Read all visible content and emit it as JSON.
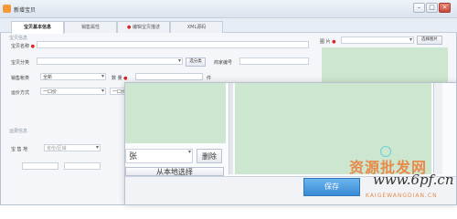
{
  "window": {
    "title": "新增宝贝"
  },
  "tabs": [
    {
      "label": "宝贝基本信息",
      "required": false
    },
    {
      "label": "销售属性",
      "required": false
    },
    {
      "label": "编辑宝贝描述",
      "required": true
    },
    {
      "label": "XML源码",
      "required": false
    }
  ],
  "basic": {
    "section_title": "宝贝信息",
    "name_label": "宝贝名称",
    "category_label": "宝贝分类",
    "category_button": "选分类",
    "merchant_code_label": "商家编号",
    "sale_label": "销售帐类",
    "sale_value": "全新",
    "qty_label": "数 量",
    "qty_unit": "件",
    "ship_label": "运价方式",
    "ship_value": "一口价",
    "ship_value2": "一口价",
    "section2_title": "运费信息",
    "other_label": "宝 售 地",
    "other_value": "省份/区域"
  },
  "image_panel": {
    "label": "图 片",
    "select_button": "选择图片"
  },
  "dialog": {
    "dropdown_value": "张",
    "delete_button": "删除",
    "local_button": "从本地选择",
    "save_button": "保存"
  },
  "watermark": {
    "cn": "资源批发网",
    "url": "www.6pf.cn",
    "sub": "KAIGEWANGDIAN.CN"
  }
}
